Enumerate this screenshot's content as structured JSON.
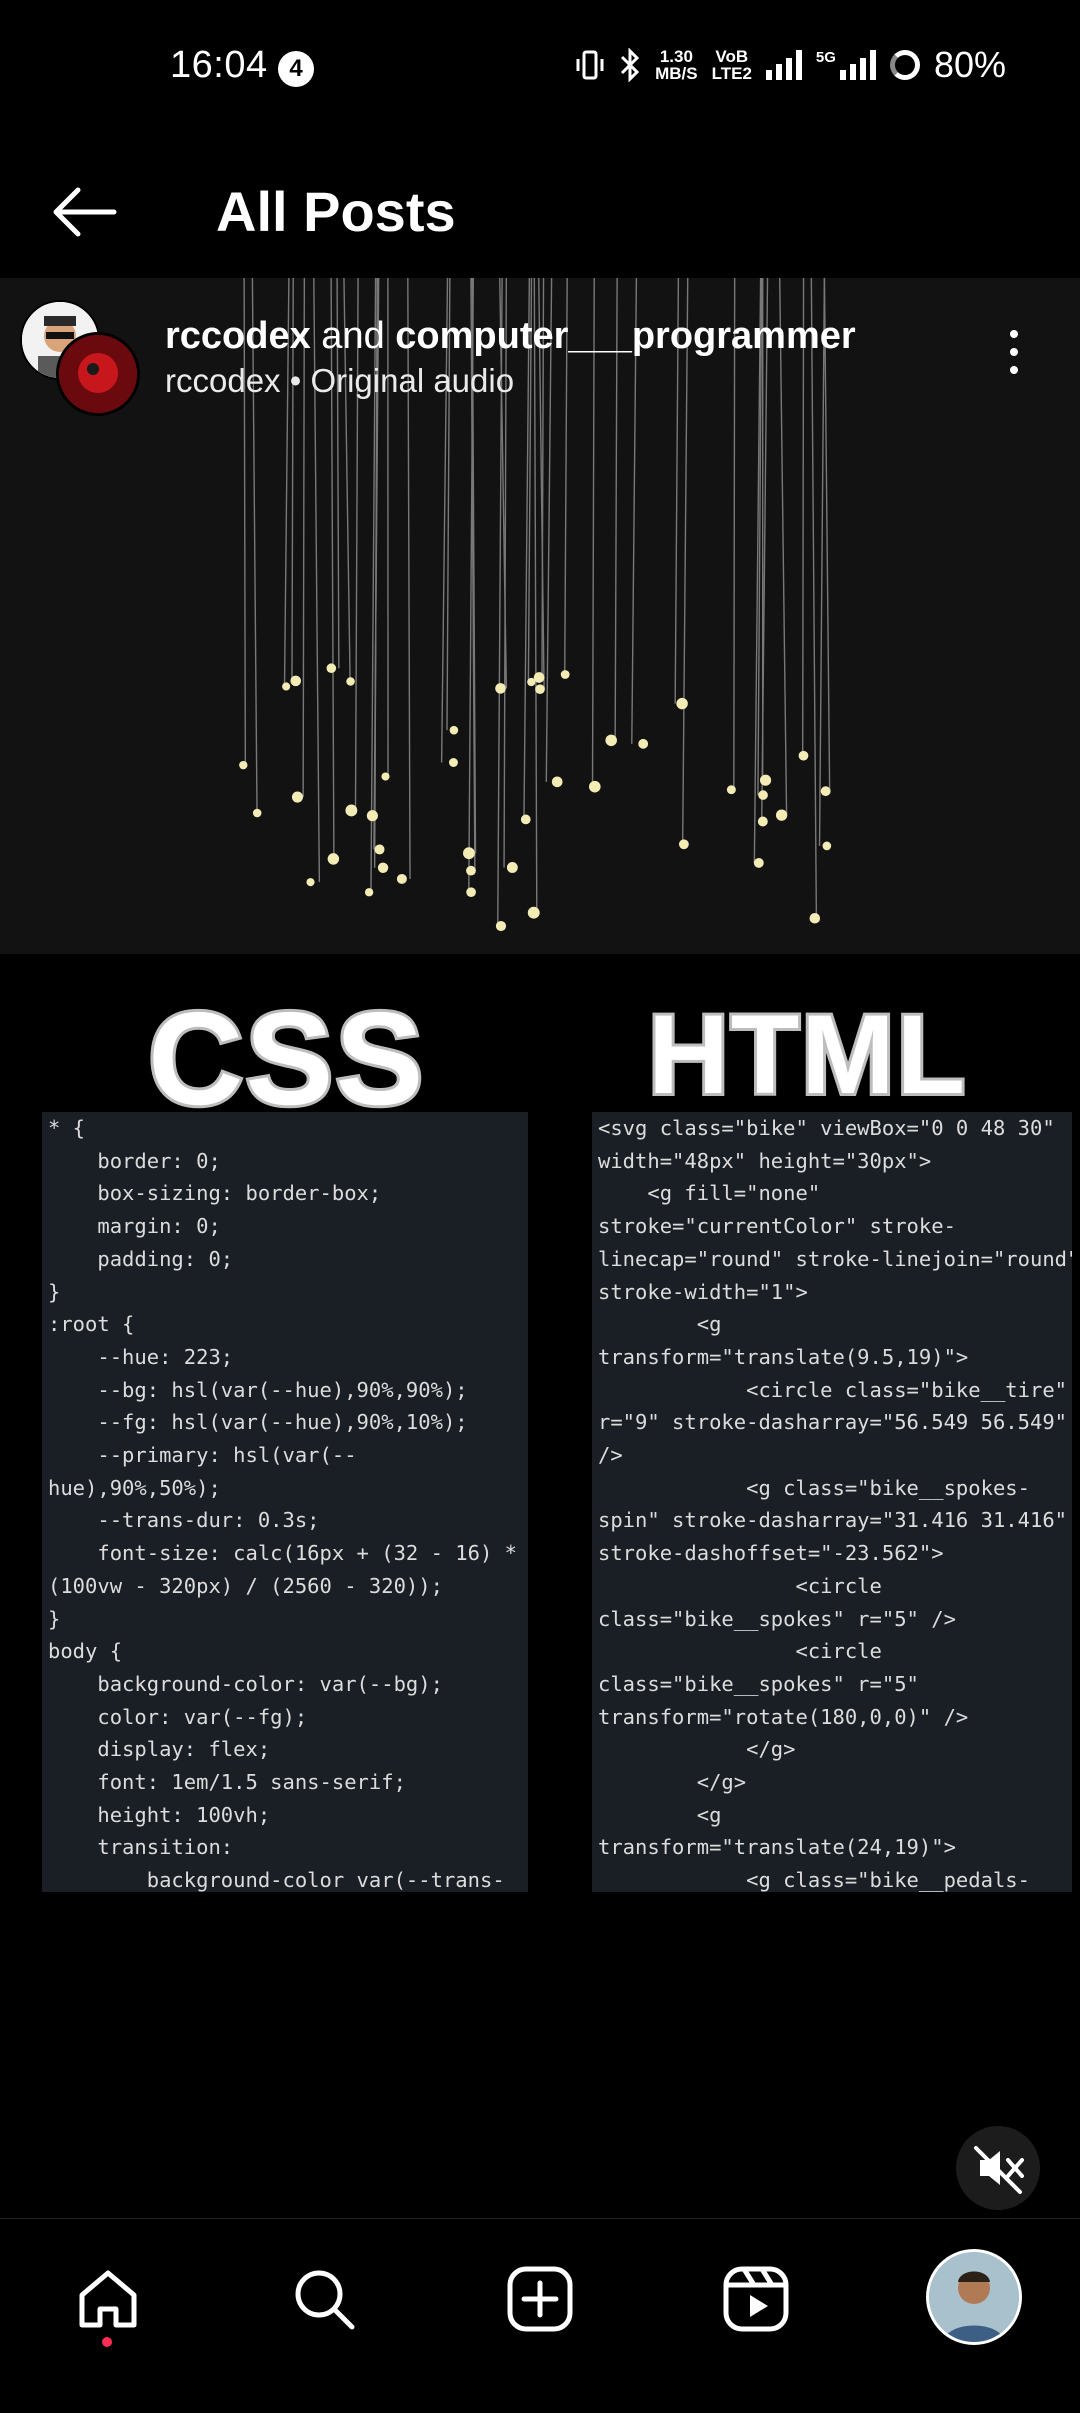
{
  "status_bar": {
    "time": "16:04",
    "notification_count": "4",
    "speed_value": "1.30",
    "speed_unit": "MB/S",
    "volte_top": "VoB",
    "volte_bottom": "LTE2",
    "network": "5G",
    "battery": "80%"
  },
  "header": {
    "title": "All Posts"
  },
  "post": {
    "author1": "rccodex",
    "joiner": " and ",
    "author2": "computer___programmer",
    "audio": "rccodex • Original audio"
  },
  "media": {
    "css_label": "CSS",
    "html_label": "HTML",
    "css_code": "* {\n    border: 0;\n    box-sizing: border-box;\n    margin: 0;\n    padding: 0;\n}\n:root {\n    --hue: 223;\n    --bg: hsl(var(--hue),90%,90%);\n    --fg: hsl(var(--hue),90%,10%);\n    --primary: hsl(var(--\nhue),90%,50%);\n    --trans-dur: 0.3s;\n    font-size: calc(16px + (32 - 16) *\n(100vw - 320px) / (2560 - 320));\n}\nbody {\n    background-color: var(--bg);\n    color: var(--fg);\n    display: flex;\n    font: 1em/1.5 sans-serif;\n    height: 100vh;\n    transition:\n        background-color var(--trans-",
    "html_code": "<svg class=\"bike\" viewBox=\"0 0 48 30\"\nwidth=\"48px\" height=\"30px\">\n    <g fill=\"none\"\nstroke=\"currentColor\" stroke-\nlinecap=\"round\" stroke-linejoin=\"round\"\nstroke-width=\"1\">\n        <g\ntransform=\"translate(9.5,19)\">\n            <circle class=\"bike__tire\"\nr=\"9\" stroke-dasharray=\"56.549 56.549\"\n/>\n            <g class=\"bike__spokes-\nspin\" stroke-dasharray=\"31.416 31.416\"\nstroke-dashoffset=\"-23.562\">\n                <circle\nclass=\"bike__spokes\" r=\"5\" />\n                <circle\nclass=\"bike__spokes\" r=\"5\"\ntransform=\"rotate(180,0,0)\" />\n            </g>\n        </g>\n        <g\ntransform=\"translate(24,19)\">\n            <g class=\"bike__pedals-"
  },
  "nav": {
    "items": [
      "home-icon",
      "search-icon",
      "create-icon",
      "reels-icon",
      "profile-avatar"
    ]
  }
}
